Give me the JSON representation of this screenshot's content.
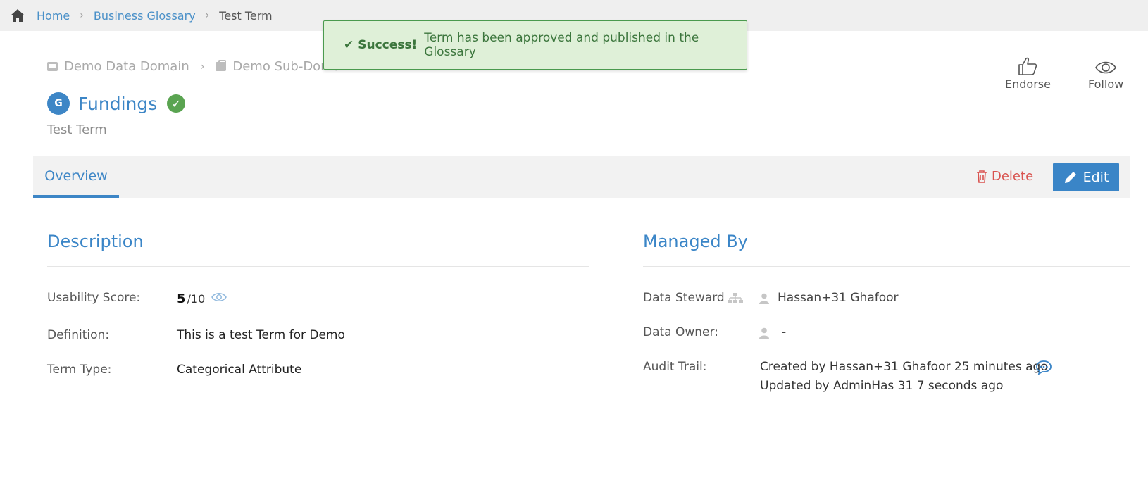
{
  "breadcrumb": {
    "items": [
      "Home",
      "Business Glossary"
    ],
    "current": "Test Term"
  },
  "toast": {
    "strong": "Success!",
    "message": "Term has been approved and published in the Glossary",
    "color": "#3c763d"
  },
  "domains": {
    "domain": "Demo Data Domain",
    "subdomain": "Demo Sub-Domain"
  },
  "term": {
    "badge": "G",
    "title": "Fundings",
    "subtitle": "Test Term"
  },
  "actions": {
    "endorse": "Endorse",
    "follow": "Follow"
  },
  "tabs": {
    "overview": "Overview",
    "delete": "Delete",
    "edit": "Edit"
  },
  "description": {
    "title": "Description",
    "usability_label": "Usability Score:",
    "usability_score": "5",
    "usability_max": "/10",
    "definition_label": "Definition:",
    "definition": "This is a test Term for Demo",
    "term_type_label": "Term Type:",
    "term_type": "Categorical Attribute"
  },
  "managed_by": {
    "title": "Managed By",
    "steward_label": "Data Steward",
    "steward": "Hassan+31 Ghafoor",
    "owner_label": "Data Owner:",
    "owner": "-",
    "audit_label": "Audit Trail:",
    "audit_created": "Created by Hassan+31 Ghafoor 25 minutes ago",
    "audit_updated": "Updated by AdminHas 31 7 seconds ago"
  },
  "colors": {
    "accent": "#3a85c7",
    "success": "#5aa451",
    "danger": "#d9534f"
  }
}
